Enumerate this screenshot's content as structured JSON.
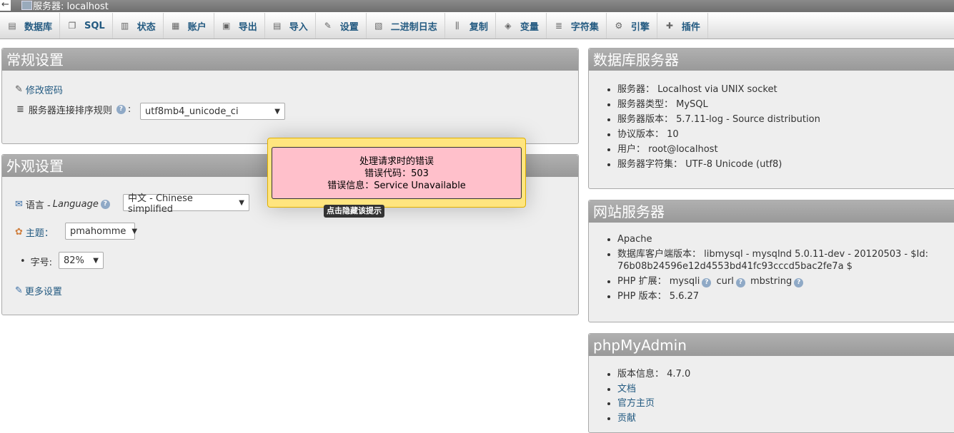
{
  "topbar": {
    "back_arrow": "←",
    "breadcrumb": "服务器: localhost"
  },
  "tabs": [
    {
      "label": "数据库",
      "icon": "database-icon",
      "glyph": "▤"
    },
    {
      "label": "SQL",
      "icon": "sql-icon",
      "glyph": "❐"
    },
    {
      "label": "状态",
      "icon": "status-icon",
      "glyph": "▥"
    },
    {
      "label": "账户",
      "icon": "accounts-icon",
      "glyph": "▦"
    },
    {
      "label": "导出",
      "icon": "export-icon",
      "glyph": "▣"
    },
    {
      "label": "导入",
      "icon": "import-icon",
      "glyph": "▤"
    },
    {
      "label": "设置",
      "icon": "wrench-icon",
      "glyph": "✎"
    },
    {
      "label": "二进制日志",
      "icon": "binlog-icon",
      "glyph": "▧"
    },
    {
      "label": "复制",
      "icon": "replication-icon",
      "glyph": "⫼"
    },
    {
      "label": "变量",
      "icon": "variables-icon",
      "glyph": "◈"
    },
    {
      "label": "字符集",
      "icon": "charset-icon",
      "glyph": "≣"
    },
    {
      "label": "引擎",
      "icon": "engine-icon",
      "glyph": "⚙"
    },
    {
      "label": "插件",
      "icon": "plugin-icon",
      "glyph": "✚"
    }
  ],
  "general": {
    "title": "常规设置",
    "change_password": "修改密码",
    "collation_label": "服务器连接排序规则",
    "collation_value": "utf8mb4_unicode_ci"
  },
  "appearance": {
    "title": "外观设置",
    "language_label": "语言 - ",
    "language_italic": "Language",
    "language_value": "中文 - Chinese simplified",
    "theme_label": "主题：",
    "theme_value": "pmahomme",
    "font_label": "字号:",
    "font_value": "82%",
    "more_settings": "更多设置"
  },
  "db_server": {
    "title": "数据库服务器",
    "items": [
      "服务器： Localhost via UNIX socket",
      "服务器类型： MySQL",
      "服务器版本： 5.7.11-log - Source distribution",
      "协议版本： 10",
      "用户： root@localhost",
      "服务器字符集： UTF-8 Unicode (utf8)"
    ]
  },
  "web_server": {
    "title": "网站服务器",
    "apache": "Apache",
    "client_version": "数据库客户端版本： libmysql - mysqlnd 5.0.11-dev - 20120503 - $Id: 76b08b24596e12d4553bd41fc93cccd5bac2fe7a $",
    "php_ext_label": "PHP 扩展： ",
    "php_ext": [
      "mysqli",
      "curl",
      "mbstring"
    ],
    "php_version": "PHP 版本： 5.6.27"
  },
  "pma": {
    "title": "phpMyAdmin",
    "version": "版本信息： 4.7.0",
    "docs": "文档",
    "homepage": "官方主页",
    "contribute": "贡献"
  },
  "error": {
    "line1": "处理请求时的错误",
    "line2": "错误代码：503",
    "line3": "错误信息：Service Unavailable",
    "tooltip": "点击隐藏该提示"
  },
  "colors": {
    "link": "#235a81",
    "error_bg": "#ffc0cb",
    "notice_bg": "#ffe57f"
  }
}
